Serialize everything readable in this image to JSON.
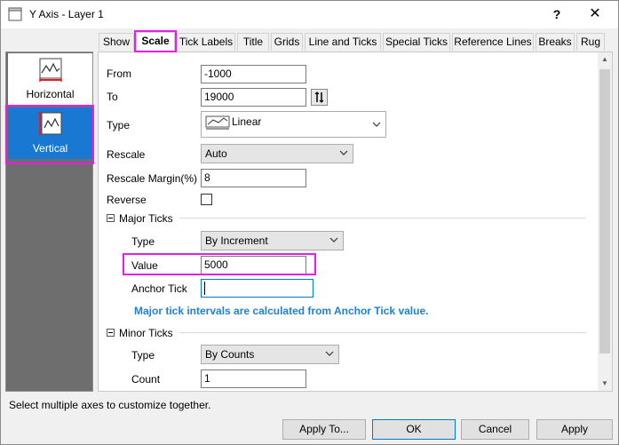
{
  "window": {
    "title": "Y Axis - Layer 1",
    "help_label": "?",
    "close_label": "✕"
  },
  "axes": [
    {
      "label": "Horizontal",
      "selected": false
    },
    {
      "label": "Vertical",
      "selected": true
    }
  ],
  "tabs": [
    "Show",
    "Scale",
    "Tick Labels",
    "Title",
    "Grids",
    "Line and Ticks",
    "Special Ticks",
    "Reference Lines",
    "Breaks",
    "Rug"
  ],
  "active_tab": "Scale",
  "scale": {
    "from_label": "From",
    "from_value": "-1000",
    "to_label": "To",
    "to_value": "19000",
    "type_label": "Type",
    "type_value": "Linear",
    "rescale_label": "Rescale",
    "rescale_value": "Auto",
    "rescale_margin_label": "Rescale Margin(%)",
    "rescale_margin_value": "8",
    "reverse_label": "Reverse",
    "reverse_checked": false
  },
  "major_ticks": {
    "section_label": "Major Ticks",
    "type_label": "Type",
    "type_value": "By Increment",
    "value_label": "Value",
    "value_value": "5000",
    "anchor_label": "Anchor Tick",
    "anchor_value": "",
    "info": "Major tick intervals are calculated from Anchor Tick value."
  },
  "minor_ticks": {
    "section_label": "Minor Ticks",
    "type_label": "Type",
    "type_value": "By Counts",
    "count_label": "Count",
    "count_value": "1"
  },
  "status": "Select multiple axes to customize together.",
  "buttons": {
    "apply_to": "Apply To...",
    "ok": "OK",
    "cancel": "Cancel",
    "apply": "Apply"
  },
  "colors": {
    "highlight": "#e61ee6",
    "selection": "#1979d2",
    "info_text": "#1f80d9"
  }
}
